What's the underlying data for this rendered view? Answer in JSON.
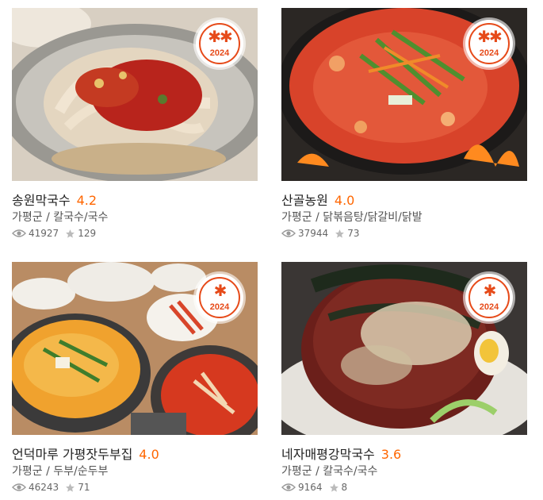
{
  "cards": [
    {
      "name": "송원막국수",
      "score": "4.2",
      "category": "가평군 / 칼국수/국수",
      "views": "41927",
      "stars": "129",
      "badge_stars": "✱✱",
      "badge_year": "2024"
    },
    {
      "name": "산골농원",
      "score": "4.0",
      "category": "가평군 / 닭볶음탕/닭갈비/닭발",
      "views": "37944",
      "stars": "73",
      "badge_stars": "✱✱",
      "badge_year": "2024"
    },
    {
      "name": "언덕마루 가평잣두부집",
      "score": "4.0",
      "category": "가평군 / 두부/순두부",
      "views": "46243",
      "stars": "71",
      "badge_stars": "✱",
      "badge_year": "2024"
    },
    {
      "name": "네자매평강막국수",
      "score": "3.6",
      "category": "가평군 / 칼국수/국수",
      "views": "9164",
      "stars": "8",
      "badge_stars": "✱",
      "badge_year": "2024"
    }
  ],
  "colors": {
    "accent": "#ff6600",
    "badge": "#e64a19"
  }
}
